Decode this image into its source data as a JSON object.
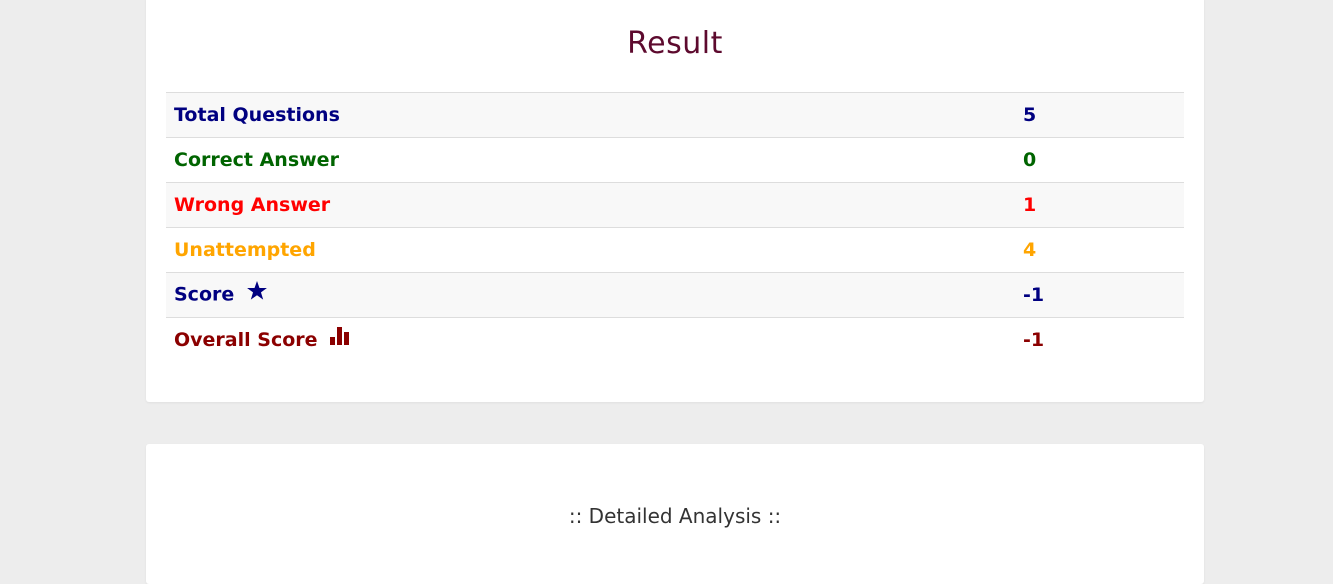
{
  "result": {
    "title": "Result",
    "rows": [
      {
        "label": "Total Questions",
        "value": "5",
        "color": "#000080"
      },
      {
        "label": "Correct Answer",
        "value": "0",
        "color": "#006400"
      },
      {
        "label": "Wrong Answer",
        "value": "1",
        "color": "#ff0000"
      },
      {
        "label": "Unattempted",
        "value": "4",
        "color": "#ffa500"
      },
      {
        "label": "Score",
        "value": "-1",
        "color": "#000080",
        "icon": "star-icon"
      },
      {
        "label": "Overall Score",
        "value": "-1",
        "color": "#8b0000",
        "icon": "bar-chart-icon"
      }
    ]
  },
  "analysis": {
    "title": ":: Detailed Analysis ::"
  },
  "colors": {
    "background": "#ededed",
    "card": "#ffffff",
    "title": "#5d0a2e",
    "row_stripe": "#f8f8f8"
  }
}
